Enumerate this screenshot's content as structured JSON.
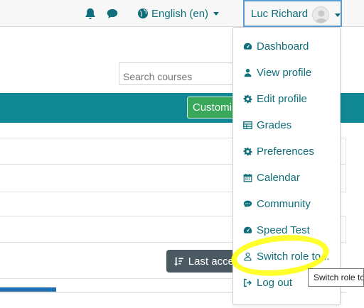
{
  "header": {
    "language_label": "English ‎(en)‎",
    "user_name": "Luc Richard"
  },
  "search": {
    "placeholder": "Search courses"
  },
  "buttons": {
    "customise_label": "Customise",
    "last_access_label": "Last access"
  },
  "user_menu": {
    "items": [
      {
        "label": "Dashboard",
        "icon": "dashboard-icon"
      },
      {
        "label": "View profile",
        "icon": "user-icon"
      },
      {
        "label": "Edit profile",
        "icon": "cog-icon"
      },
      {
        "label": "Grades",
        "icon": "table-icon"
      },
      {
        "label": "Preferences",
        "icon": "cog-icon"
      },
      {
        "label": "Calendar",
        "icon": "calendar-icon"
      },
      {
        "label": "Community",
        "icon": "comment-icon"
      },
      {
        "label": "Speed Test",
        "icon": "dashboard-icon"
      },
      {
        "label": "Switch role to...",
        "icon": "user-outline-icon"
      },
      {
        "label": "Log out",
        "icon": "sign-out-icon"
      }
    ]
  },
  "tooltip": {
    "text": "Switch role to..."
  },
  "colors": {
    "link_teal": "#0f6e79",
    "band_teal": "#0f8794",
    "success_green": "#39a85a",
    "highlight_yellow": "#ffff1a",
    "focus_blue": "#5a9bd5"
  }
}
